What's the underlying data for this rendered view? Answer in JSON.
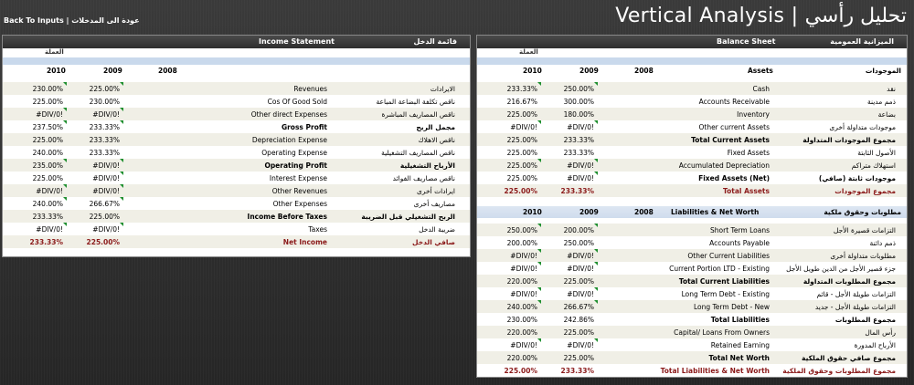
{
  "header": {
    "back_link": "Back To Inputs | عودة الى المدخلات",
    "title": "Vertical Analysis | تحليل رأسي"
  },
  "income_statement": {
    "title_ar": "قائمة الدخل",
    "title_en": "Income Statement",
    "currency_label": "العملة",
    "years": [
      "2010",
      "2009",
      "2008"
    ],
    "rows": [
      {
        "ar": "الايرادات",
        "en": "Revenues",
        "v2010": "230.00%",
        "v2009": "225.00%",
        "bold": false
      },
      {
        "ar": "ناقص تكلفة البضاعة المباعة",
        "en": "Cos Of Good Sold",
        "v2010": "225.00%",
        "v2009": "230.00%",
        "bold": false
      },
      {
        "ar": "ناقص المصاريف المباشرة",
        "en": "Other direct Expenses",
        "v2010": "#DIV/0!",
        "v2009": "#DIV/0!",
        "bold": false
      },
      {
        "ar": "مجمل الربح",
        "en": "Gross Profit",
        "v2010": "237.50%",
        "v2009": "233.33%",
        "bold": true
      },
      {
        "ar": "ناقص الاهلاك",
        "en": "Depreciation Expense",
        "v2010": "225.00%",
        "v2009": "233.33%",
        "bold": false
      },
      {
        "ar": "ناقص المصاريف التشغيلية",
        "en": "Operating Expense",
        "v2010": "240.00%",
        "v2009": "233.33%",
        "bold": false
      },
      {
        "ar": "الأرباح التشغيلية",
        "en": "Operating Profit",
        "v2010": "235.00%",
        "v2009": "#DIV/0!",
        "bold": true
      },
      {
        "ar": "ناقص مصاريف الفوائد",
        "en": "Interest Expense",
        "v2010": "225.00%",
        "v2009": "#DIV/0!",
        "bold": false
      },
      {
        "ar": "ايرادات أخرى",
        "en": "Other Revenues",
        "v2010": "#DIV/0!",
        "v2009": "#DIV/0!",
        "bold": false
      },
      {
        "ar": "مصاريف أخرى",
        "en": "Other Expenses",
        "v2010": "240.00%",
        "v2009": "266.67%",
        "bold": false
      },
      {
        "ar": "الربح التشغيلي قبل الضريبة",
        "en": "Income Before Taxes",
        "v2010": "233.33%",
        "v2009": "225.00%",
        "bold": true
      },
      {
        "ar": "ضريبة الدخل",
        "en": "Taxes",
        "v2010": "#DIV/0!",
        "v2009": "#DIV/0!",
        "bold": false
      },
      {
        "ar": "صافي الدخل",
        "en": "Net Income",
        "v2010": "233.33%",
        "v2009": "225.00%",
        "total": true
      }
    ]
  },
  "balance_sheet": {
    "title_ar": "الميزانية العمومية",
    "title_en": "Balance Sheet",
    "currency_label": "العملة",
    "years": [
      "2010",
      "2009",
      "2008"
    ],
    "assets_heading_en": "Assets",
    "assets_heading_ar": "الموجودات",
    "assets": [
      {
        "ar": "نقد",
        "en": "Cash",
        "v2010": "233.33%",
        "v2009": "250.00%"
      },
      {
        "ar": "ذمم مدينة",
        "en": "Accounts Receivable",
        "v2010": "216.67%",
        "v2009": "300.00%"
      },
      {
        "ar": "بضاعة",
        "en": "Inventory",
        "v2010": "225.00%",
        "v2009": "180.00%"
      },
      {
        "ar": "موجودات متداولة أخرى",
        "en": "Other current Assets",
        "v2010": "#DIV/0!",
        "v2009": "#DIV/0!"
      },
      {
        "ar": "مجموع الموجودات المتداولة",
        "en": "Total Current Assets",
        "v2010": "225.00%",
        "v2009": "233.33%",
        "bold": true
      },
      {
        "ar": "الأصول الثابتة",
        "en": "Fixed Assets",
        "v2010": "225.00%",
        "v2009": "233.33%"
      },
      {
        "ar": "استهلاك متراكم",
        "en": "Accumulated Depreciation",
        "v2010": "225.00%",
        "v2009": "#DIV/0!"
      },
      {
        "ar": "موجودات ثابتة (صافي)",
        "en": "Fixed Assets (Net)",
        "v2010": "225.00%",
        "v2009": "#DIV/0!",
        "bold": true
      },
      {
        "ar": "مجموع الموجودات",
        "en": "Total Assets",
        "v2010": "225.00%",
        "v2009": "233.33%",
        "total": true
      }
    ],
    "liab_heading_en": "Liabilities & Net Worth",
    "liab_heading_ar": "مطلوبات وحقوق ملكية",
    "liabilities": [
      {
        "ar": "التزامات قصيرة الأجل",
        "en": "Short Term Loans",
        "v2010": "250.00%",
        "v2009": "200.00%"
      },
      {
        "ar": "ذمم دائنة",
        "en": "Accounts Payable",
        "v2010": "200.00%",
        "v2009": "250.00%"
      },
      {
        "ar": "مطلوبات متداولة أخرى",
        "en": "Other Current Liabilities",
        "v2010": "#DIV/0!",
        "v2009": "#DIV/0!"
      },
      {
        "ar": "جزء قصير الأجل من الدين طويل الأجل",
        "en": "Current Portion LTD - Existing",
        "v2010": "#DIV/0!",
        "v2009": "#DIV/0!"
      },
      {
        "ar": "مجموع المطلوبات المتداولة",
        "en": "Total Current Liabilities",
        "v2010": "220.00%",
        "v2009": "225.00%",
        "bold": true
      },
      {
        "ar": "التزامات طويلة الأجل - قائم",
        "en": "Long Term Debt - Existing",
        "v2010": "#DIV/0!",
        "v2009": "#DIV/0!"
      },
      {
        "ar": "التزامات طويلة الأجل - جديد",
        "en": "Long Term Debt - New",
        "v2010": "240.00%",
        "v2009": "266.67%"
      },
      {
        "ar": "مجموع المطلوبات",
        "en": "Total Liabilities",
        "v2010": "230.00%",
        "v2009": "242.86%",
        "bold": true
      },
      {
        "ar": "رأس المال",
        "en": "Capital/ Loans From Owners",
        "v2010": "220.00%",
        "v2009": "225.00%"
      },
      {
        "ar": "الأرباح المدورة",
        "en": "Retained Earning",
        "v2010": "#DIV/0!",
        "v2009": "#DIV/0!"
      },
      {
        "ar": "مجموع صافي حقوق الملكية",
        "en": "Total Net Worth",
        "v2010": "220.00%",
        "v2009": "225.00%",
        "bold": true
      },
      {
        "ar": "مجموع المطلوبات وحقوق الملكية",
        "en": "Total Liabilities & Net Worth",
        "v2010": "225.00%",
        "v2009": "233.33%",
        "total": true
      }
    ]
  }
}
